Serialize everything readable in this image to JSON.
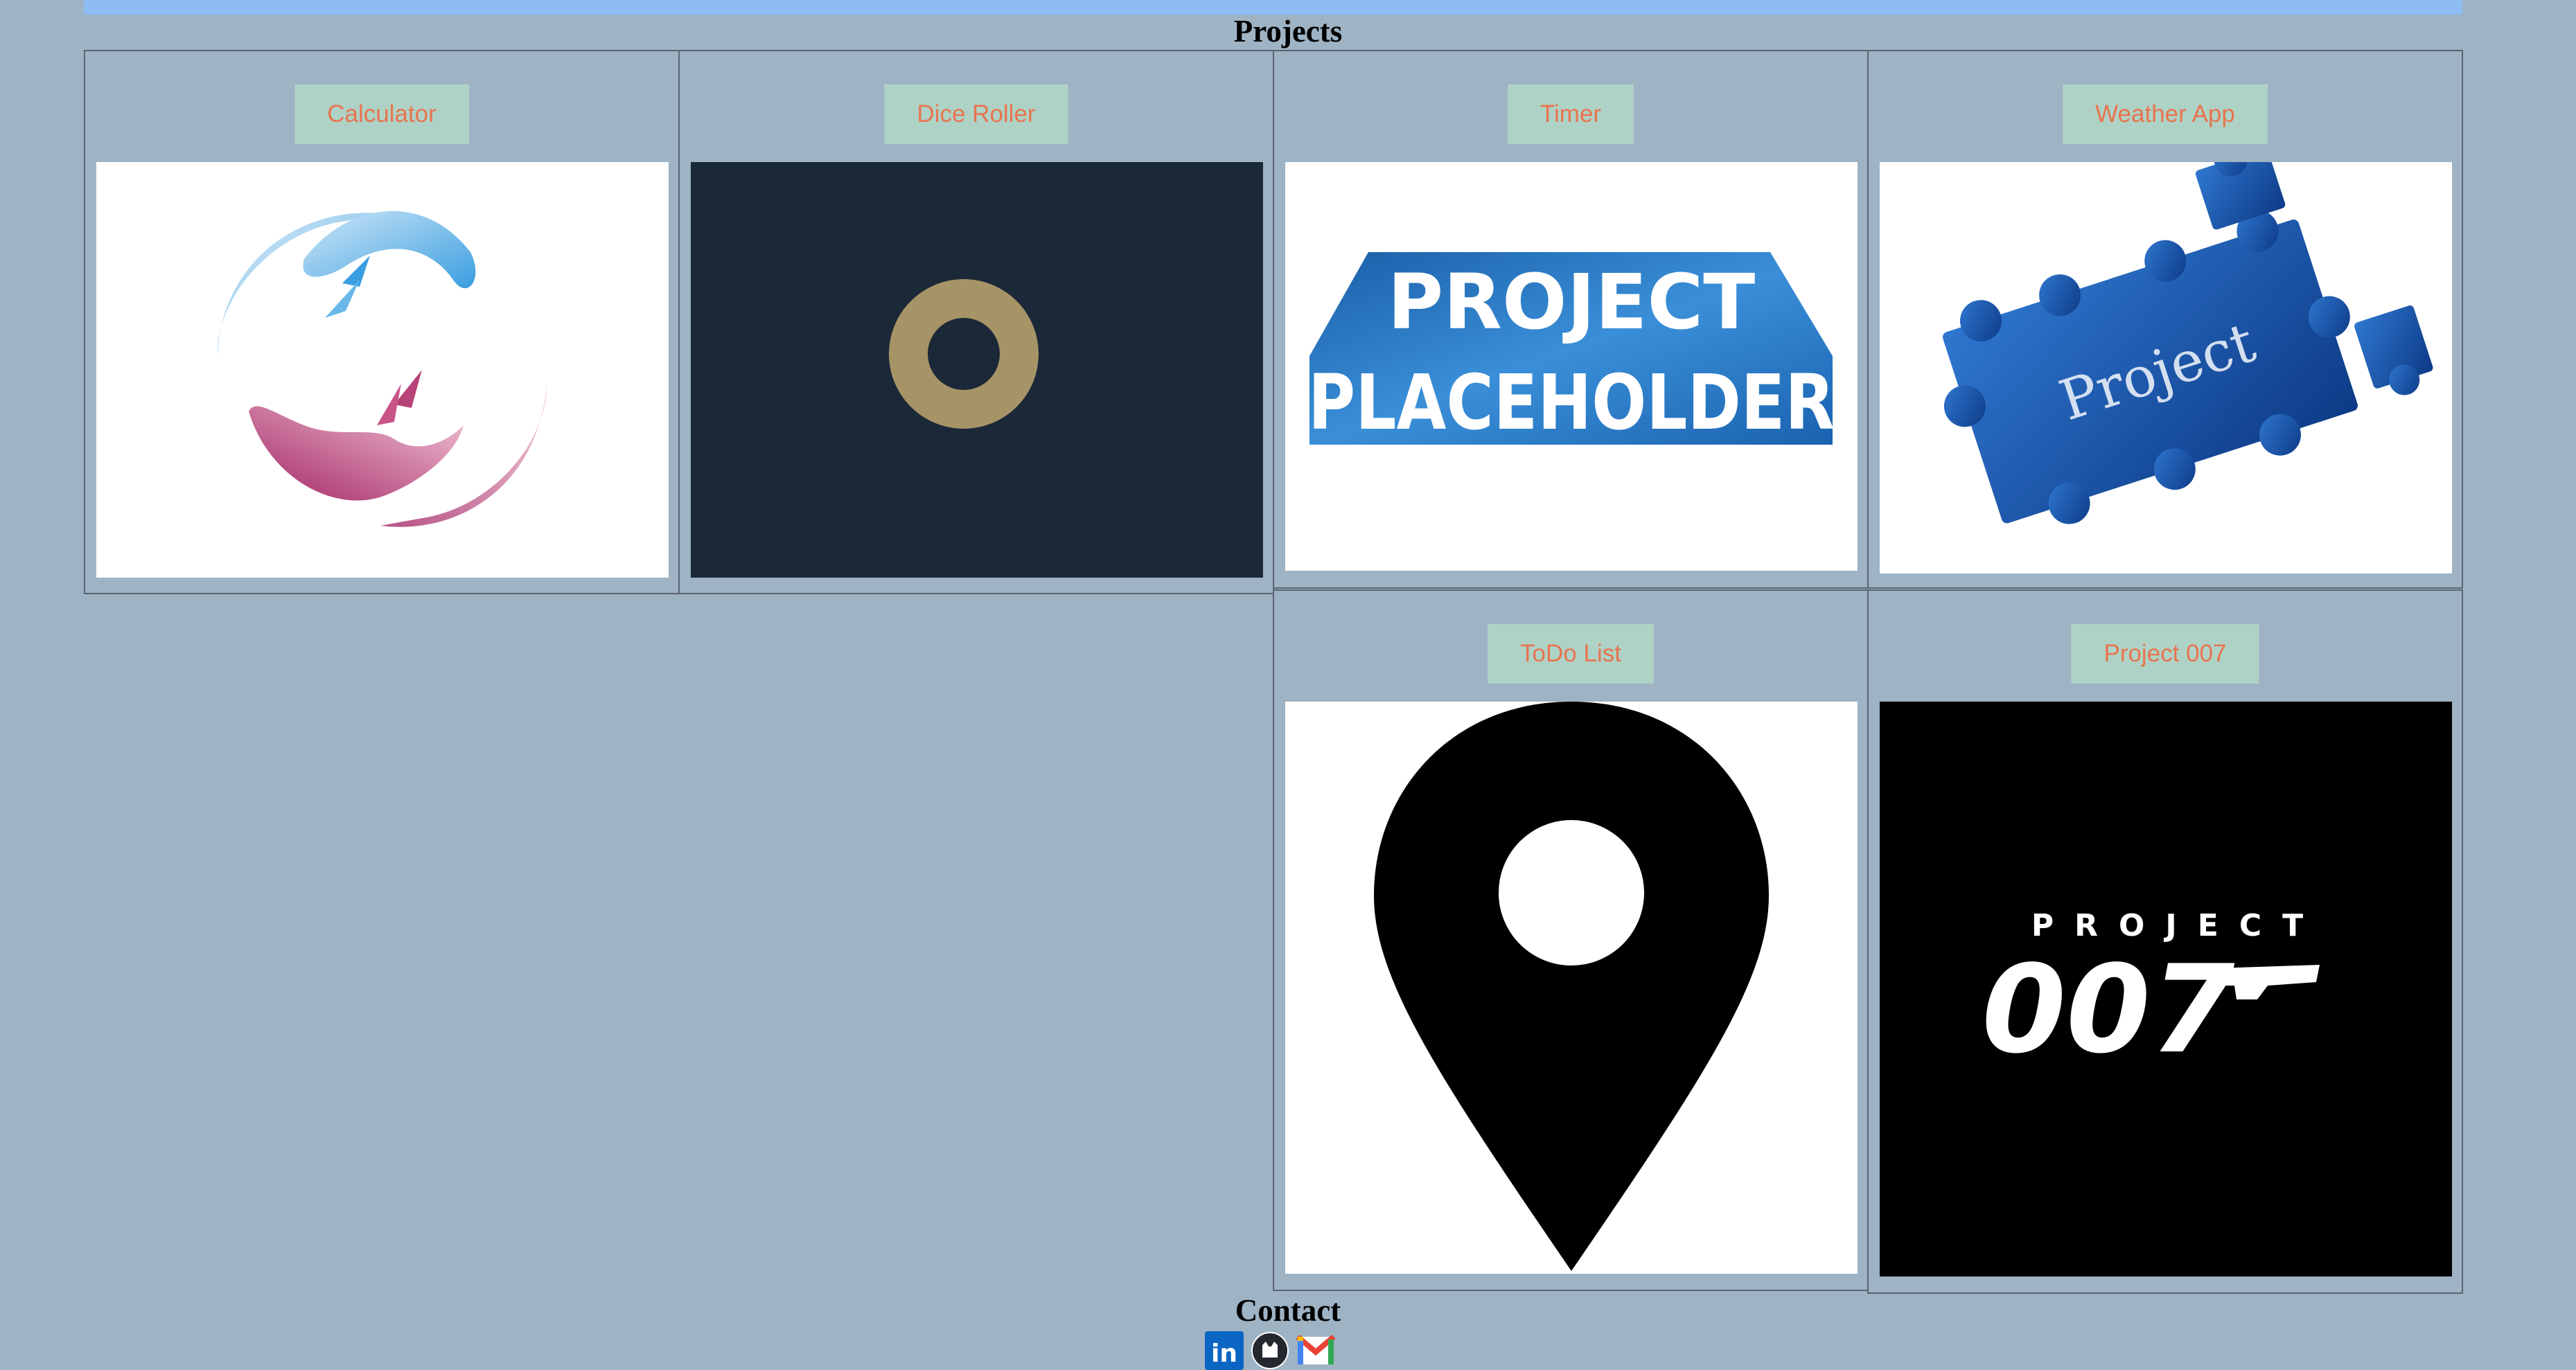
{
  "section": {
    "title": "Projects"
  },
  "projects": [
    {
      "label": "Calculator",
      "image": "hands-circle-logo"
    },
    {
      "label": "Dice Roller",
      "image": "gold-ring-dark-background"
    },
    {
      "label": "Timer",
      "image": "project-placeholder-banner"
    },
    {
      "label": "Weather App",
      "image": "puzzle-project-graphic",
      "image_text": "Project"
    },
    {
      "label": "ToDo List",
      "image": "map-pin"
    },
    {
      "label": "Project 007",
      "image": "project-007-logo"
    }
  ],
  "timer_image_text": {
    "line1": "PROJECT",
    "line2": "PLACEHOLDER"
  },
  "project007_image_text": {
    "line1": "PROJECT",
    "line2": "007"
  },
  "contact": {
    "title": "Contact",
    "links": [
      {
        "icon": "linkedin-icon",
        "text": "in"
      },
      {
        "icon": "github-icon"
      },
      {
        "icon": "gmail-icon"
      }
    ]
  },
  "colors": {
    "page_background": "#9eb3c4",
    "top_bar": "#8ebdf5",
    "button_background": "#afd2c6",
    "button_text": "#e8744e"
  }
}
